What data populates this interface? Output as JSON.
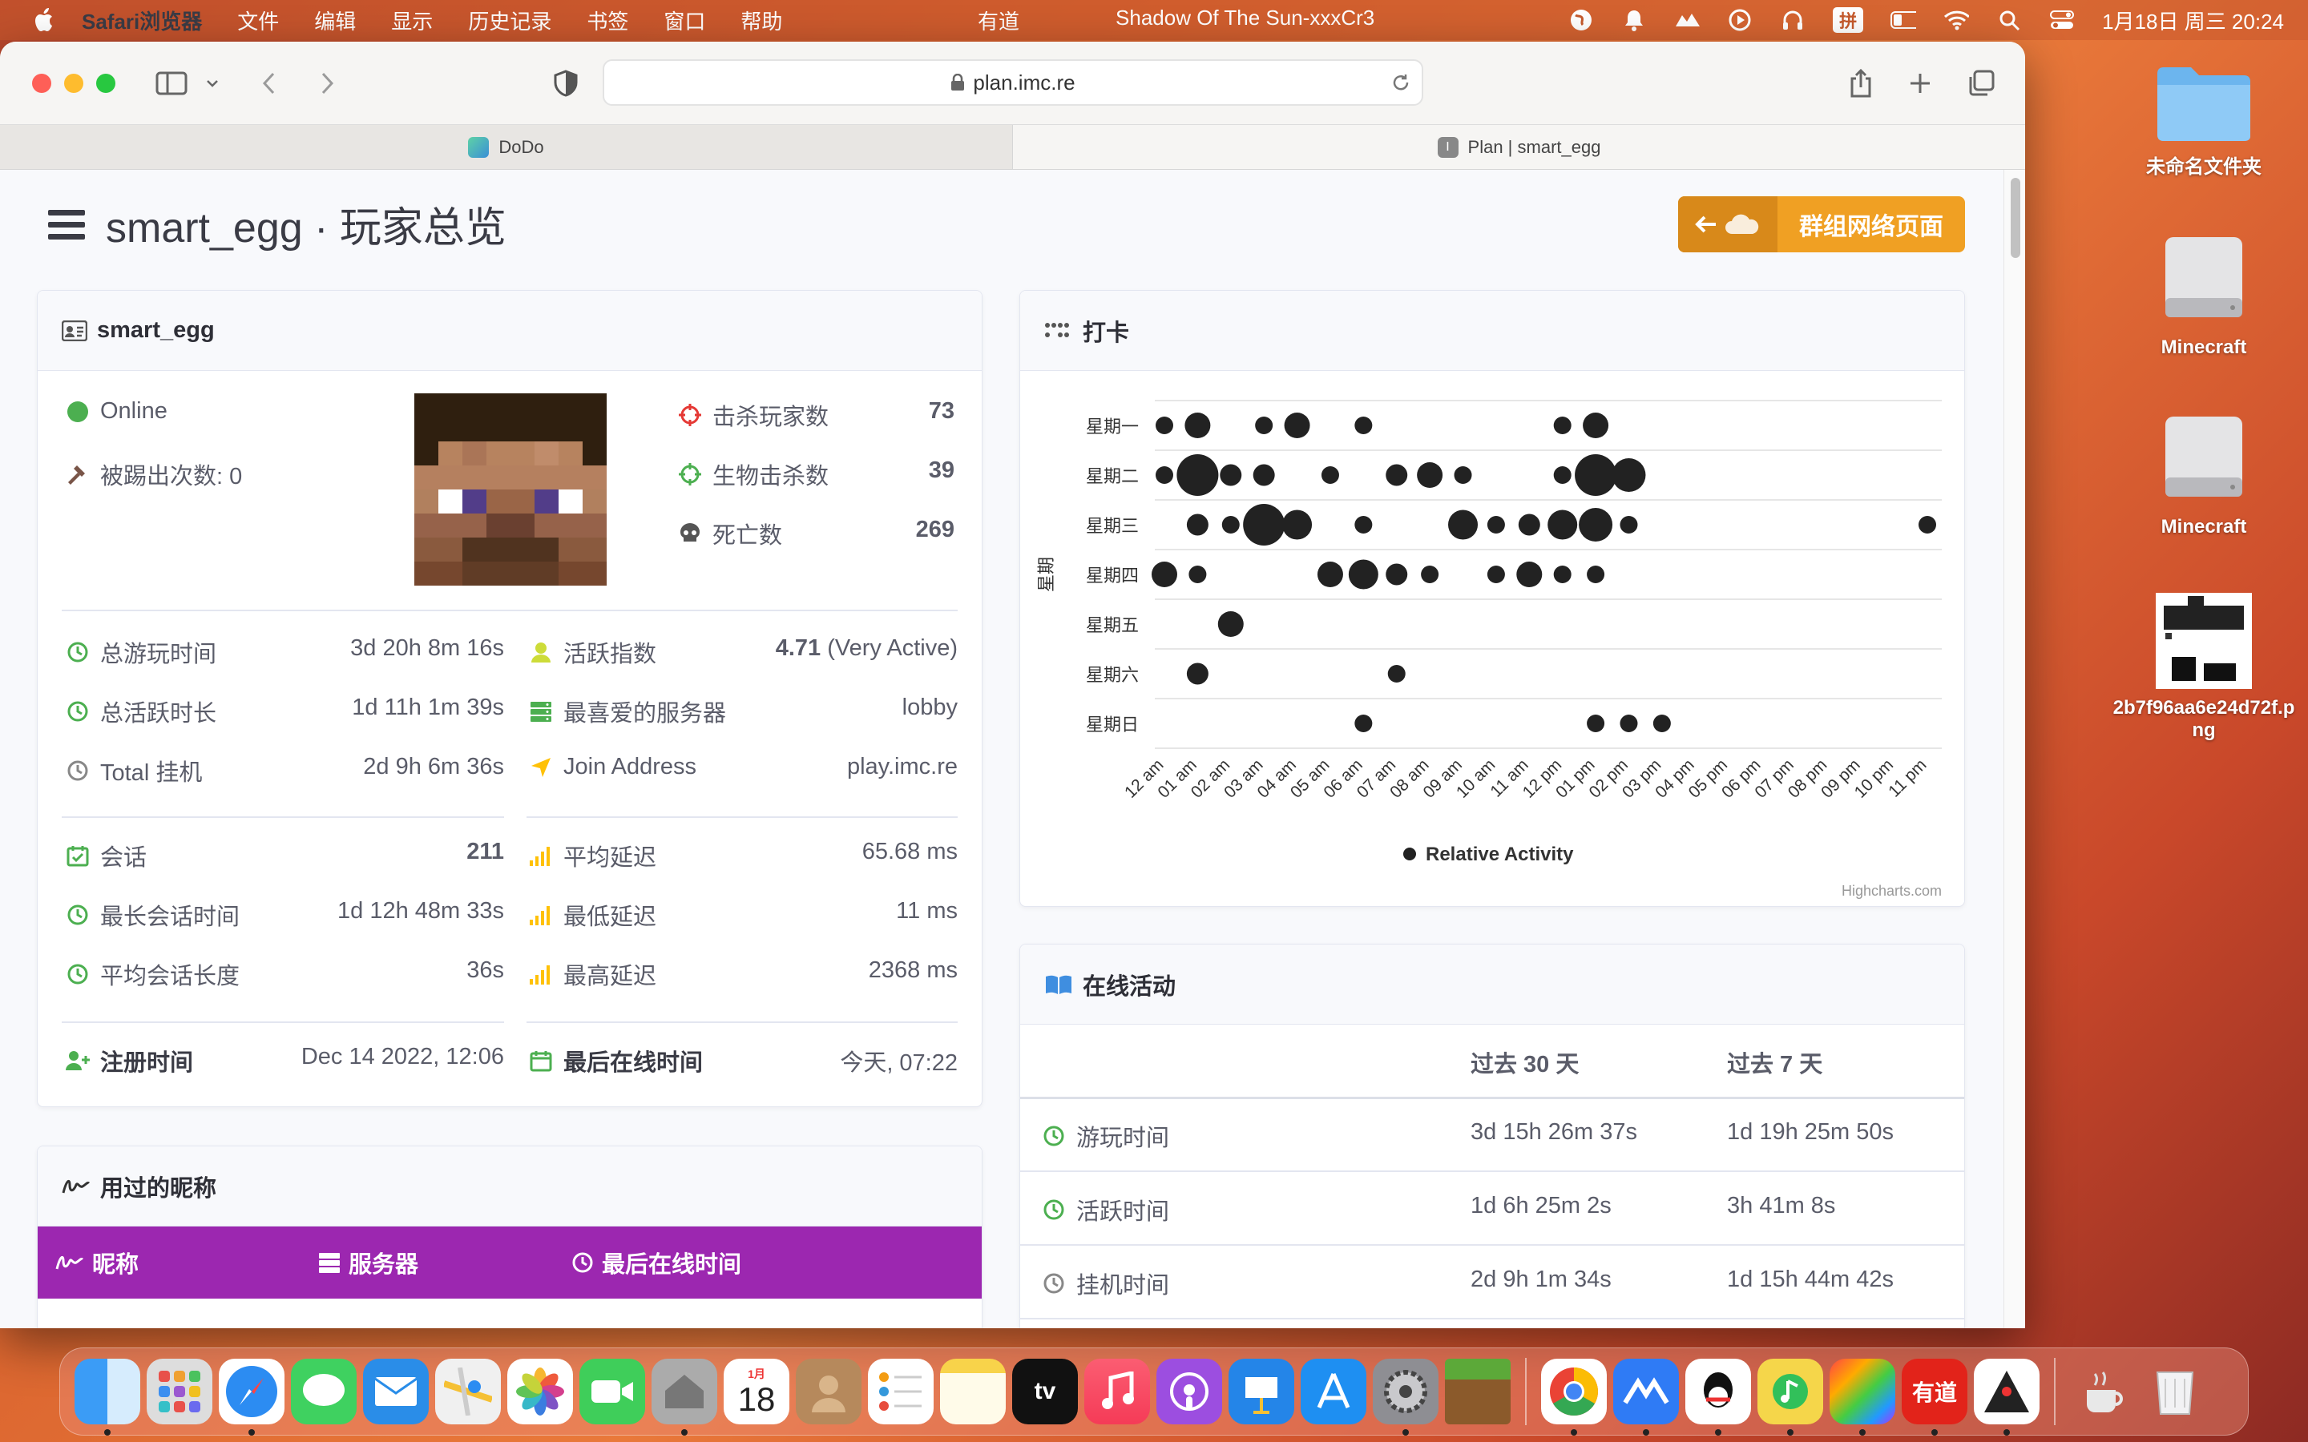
{
  "menubar": {
    "app": "Safari浏览器",
    "items": [
      "文件",
      "编辑",
      "显示",
      "历史记录",
      "书签",
      "窗口",
      "帮助"
    ],
    "center_app": "有道",
    "song": "Shadow Of The Sun-xxxCr3",
    "input": "拼",
    "datetime": "1月18日 周三  20:24"
  },
  "browser": {
    "url": "plan.imc.re",
    "tabs": [
      {
        "label": "DoDo"
      },
      {
        "label": "Plan | smart_egg"
      }
    ]
  },
  "page": {
    "title": "smart_egg · 玩家总览",
    "network_button": "群组网络页面",
    "player_card": {
      "name": "smart_egg",
      "status": "Online",
      "kicked": "被踢出次数: 0",
      "kills_label": "击杀玩家数",
      "kills": "73",
      "mob_label": "生物击杀数",
      "mob": "39",
      "death_label": "死亡数",
      "death": "269",
      "playtime_label": "总游玩时间",
      "playtime": "3d 20h 8m 16s",
      "active_label": "总活跃时长",
      "active": "1d 11h 1m 39s",
      "afk_label": "Total 挂机",
      "afk": "2d 9h 6m 36s",
      "index_label": "活跃指数",
      "index_num": "4.71",
      "index_text": "(Very Active)",
      "fav_label": "最喜爱的服务器",
      "fav": "lobby",
      "join_label": "Join Address",
      "join": "play.imc.re",
      "sessions_label": "会话",
      "sessions": "211",
      "longest_label": "最长会话时间",
      "longest": "1d 12h 48m 33s",
      "avg_session_label": "平均会话长度",
      "avg_session": "36s",
      "avg_ping_label": "平均延迟",
      "avg_ping": "65.68 ms",
      "min_ping_label": "最低延迟",
      "min_ping": "11 ms",
      "max_ping_label": "最高延迟",
      "max_ping": "2368 ms",
      "registered_label": "注册时间",
      "registered": "Dec 14 2022, 12:06",
      "last_seen_label": "最后在线时间",
      "last_seen": "今天, 07:22"
    },
    "nicknames_card": {
      "title": "用过的昵称",
      "col_nick": "昵称",
      "col_server": "服务器",
      "col_last": "最后在线时间"
    },
    "punchcard": {
      "title": "打卡",
      "credit": "Highcharts.com"
    },
    "online_activity": {
      "title": "在线活动",
      "col30": "过去 30 天",
      "col7": "过去 7 天",
      "rows": [
        {
          "label": "游玩时间",
          "d30": "3d 15h 26m 37s",
          "d7": "1d 19h 25m 50s"
        },
        {
          "label": "活跃时间",
          "d30": "1d 6h 25m 2s",
          "d7": "3h 41m 8s"
        },
        {
          "label": "挂机时间",
          "d30": "2d 9h 1m 34s",
          "d7": "1d 15h 44m 42s"
        }
      ]
    }
  },
  "desktop": [
    {
      "label": "未命名文件夹"
    },
    {
      "label": "Minecraft"
    },
    {
      "label": "Minecraft"
    },
    {
      "label": "2b7f96aa6e24d72f.png"
    }
  ],
  "dock_calendar": {
    "month": "1月",
    "day": "18"
  },
  "dock_youdao": "有道",
  "dock_tv": "tv",
  "chart_data": {
    "type": "scatter",
    "title": "",
    "ylabel": "星期",
    "y_categories": [
      "星期一",
      "星期二",
      "星期三",
      "星期四",
      "星期五",
      "星期六",
      "星期日"
    ],
    "x_categories": [
      "12 am",
      "01 am",
      "02 am",
      "03 am",
      "04 am",
      "05 am",
      "06 am",
      "07 am",
      "08 am",
      "09 am",
      "10 am",
      "11 am",
      "12 pm",
      "01 pm",
      "02 pm",
      "03 pm",
      "04 pm",
      "05 pm",
      "06 pm",
      "07 pm",
      "08 pm",
      "09 pm",
      "10 pm",
      "11 pm"
    ],
    "legend": "Relative Activity",
    "legend_position": "bottom-center",
    "color": "#222222",
    "series": [
      {
        "name": "Relative Activity",
        "points": [
          {
            "day": 0,
            "hour": 0,
            "size": 1
          },
          {
            "day": 0,
            "hour": 1,
            "size": 2
          },
          {
            "day": 0,
            "hour": 3,
            "size": 1
          },
          {
            "day": 0,
            "hour": 4,
            "size": 2
          },
          {
            "day": 0,
            "hour": 6,
            "size": 1
          },
          {
            "day": 0,
            "hour": 12,
            "size": 1
          },
          {
            "day": 0,
            "hour": 13,
            "size": 2
          },
          {
            "day": 1,
            "hour": 0,
            "size": 1
          },
          {
            "day": 1,
            "hour": 1,
            "size": 4
          },
          {
            "day": 1,
            "hour": 2,
            "size": 1.5
          },
          {
            "day": 1,
            "hour": 3,
            "size": 1.5
          },
          {
            "day": 1,
            "hour": 5,
            "size": 1
          },
          {
            "day": 1,
            "hour": 7,
            "size": 1.5
          },
          {
            "day": 1,
            "hour": 8,
            "size": 2
          },
          {
            "day": 1,
            "hour": 9,
            "size": 1
          },
          {
            "day": 1,
            "hour": 12,
            "size": 1
          },
          {
            "day": 1,
            "hour": 13,
            "size": 4
          },
          {
            "day": 1,
            "hour": 14,
            "size": 3
          },
          {
            "day": 2,
            "hour": 1,
            "size": 1.5
          },
          {
            "day": 2,
            "hour": 2,
            "size": 1
          },
          {
            "day": 2,
            "hour": 3,
            "size": 4
          },
          {
            "day": 2,
            "hour": 4,
            "size": 2.5
          },
          {
            "day": 2,
            "hour": 6,
            "size": 1
          },
          {
            "day": 2,
            "hour": 9,
            "size": 2.5
          },
          {
            "day": 2,
            "hour": 10,
            "size": 1
          },
          {
            "day": 2,
            "hour": 11,
            "size": 1.5
          },
          {
            "day": 2,
            "hour": 12,
            "size": 2.5
          },
          {
            "day": 2,
            "hour": 13,
            "size": 3
          },
          {
            "day": 2,
            "hour": 14,
            "size": 1
          },
          {
            "day": 2,
            "hour": 23,
            "size": 1
          },
          {
            "day": 3,
            "hour": 0,
            "size": 2
          },
          {
            "day": 3,
            "hour": 1,
            "size": 1
          },
          {
            "day": 3,
            "hour": 5,
            "size": 2
          },
          {
            "day": 3,
            "hour": 6,
            "size": 2.5
          },
          {
            "day": 3,
            "hour": 7,
            "size": 1.5
          },
          {
            "day": 3,
            "hour": 8,
            "size": 1
          },
          {
            "day": 3,
            "hour": 10,
            "size": 1
          },
          {
            "day": 3,
            "hour": 11,
            "size": 2
          },
          {
            "day": 3,
            "hour": 12,
            "size": 1
          },
          {
            "day": 3,
            "hour": 13,
            "size": 1
          },
          {
            "day": 4,
            "hour": 2,
            "size": 2
          },
          {
            "day": 5,
            "hour": 1,
            "size": 1.5
          },
          {
            "day": 5,
            "hour": 7,
            "size": 1
          },
          {
            "day": 6,
            "hour": 6,
            "size": 1
          },
          {
            "day": 6,
            "hour": 13,
            "size": 1
          },
          {
            "day": 6,
            "hour": 14,
            "size": 1
          },
          {
            "day": 6,
            "hour": 15,
            "size": 1
          }
        ]
      }
    ]
  }
}
